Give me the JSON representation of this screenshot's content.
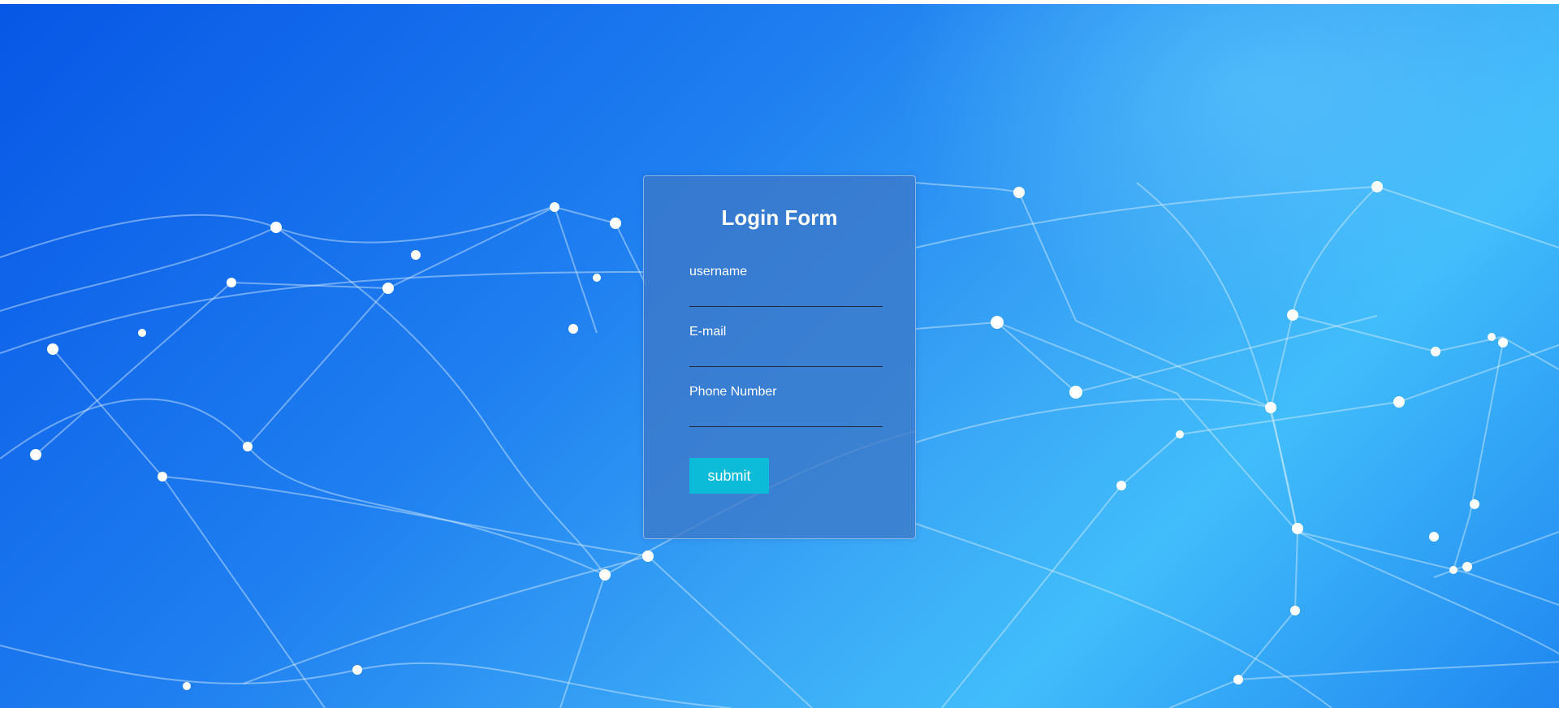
{
  "form": {
    "title": "Login Form",
    "fields": [
      {
        "label": "username",
        "value": "",
        "placeholder": ""
      },
      {
        "label": "E-mail",
        "value": "",
        "placeholder": ""
      },
      {
        "label": "Phone Number",
        "value": "",
        "placeholder": ""
      }
    ],
    "submit_label": "submit"
  },
  "colors": {
    "background_start": "#0757e6",
    "background_end": "#41bdfb",
    "card": "#3c78c8",
    "submit_button": "#0bbbd8"
  }
}
